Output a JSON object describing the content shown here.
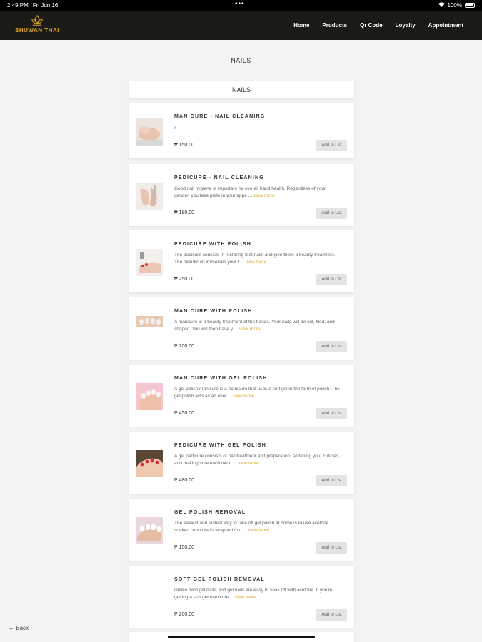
{
  "status_bar": {
    "time": "2:49 PM",
    "date": "Fri Jun 16",
    "battery": "100%"
  },
  "brand": {
    "name": "SHUWAN THAI",
    "accent_color": "#d9a528"
  },
  "nav": [
    {
      "label": "Home"
    },
    {
      "label": "Products"
    },
    {
      "label": "Qr Code"
    },
    {
      "label": "Loyalty"
    },
    {
      "label": "Appointment"
    }
  ],
  "page_title": "NAILS",
  "section_title": "NAILS",
  "add_label": "Add to List",
  "more_label": "view more",
  "items": [
    {
      "name": "MANICURE - NAIL CLEANING",
      "desc": "x",
      "price": "₱ 150.00",
      "icon": "manicure-cleaning-photo"
    },
    {
      "name": "PEDICURE - NAIL CLEANING",
      "desc": "Good nail hygiene is important for overall hand health. Regardless of your gender, you take pride in your appe ...",
      "price": "₱ 180.00",
      "icon": "pedicure-cleaning-photo"
    },
    {
      "name": "PEDICURE WITH POLISH",
      "desc": "The pedicure consists in restoring feet nails and give them a beauty treatment. The beautician immerses your f ...",
      "price": "₱ 250.00",
      "icon": "pedicure-polish-photo"
    },
    {
      "name": "MANICURE WITH POLISH",
      "desc": "A manicure is a beauty treatment of the hands. Your nails will be cut, filed, and shaped. You will then have y ...",
      "price": "₱ 200.00",
      "icon": "manicure-polish-photo"
    },
    {
      "name": "MANICURE WITH GEL POLISH",
      "desc": "A gel polish manicure is a manicure that uses a soft gel in the form of polish. The gel polish acts as an over ...",
      "price": "₱ 450.00",
      "icon": "gel-manicure-photo"
    },
    {
      "name": "PEDICURE WITH GEL POLISH",
      "desc": "A gel pedicure consists of nail treatment and preparation, softening your cuticles, and making sure each toe n ...",
      "price": "₱ 480.00",
      "icon": "gel-pedicure-photo"
    },
    {
      "name": "GEL POLISH REMOVAL",
      "desc": "The easiest and fastest way to take off gel polish at home is to use acetone soaked cotton balls wrapped in ti ...",
      "price": "₱ 150.00",
      "icon": "gel-removal-photo"
    },
    {
      "name": "SOFT GEL POLISH REMOVAL",
      "desc": "Unlike hard gel nails, soft gel nails are easy to soak off with acetone. If you're getting a soft gel manicure ...",
      "price": "₱ 200.00",
      "icon": "soft-gel-removal-photo"
    }
  ],
  "back_label": "Back"
}
